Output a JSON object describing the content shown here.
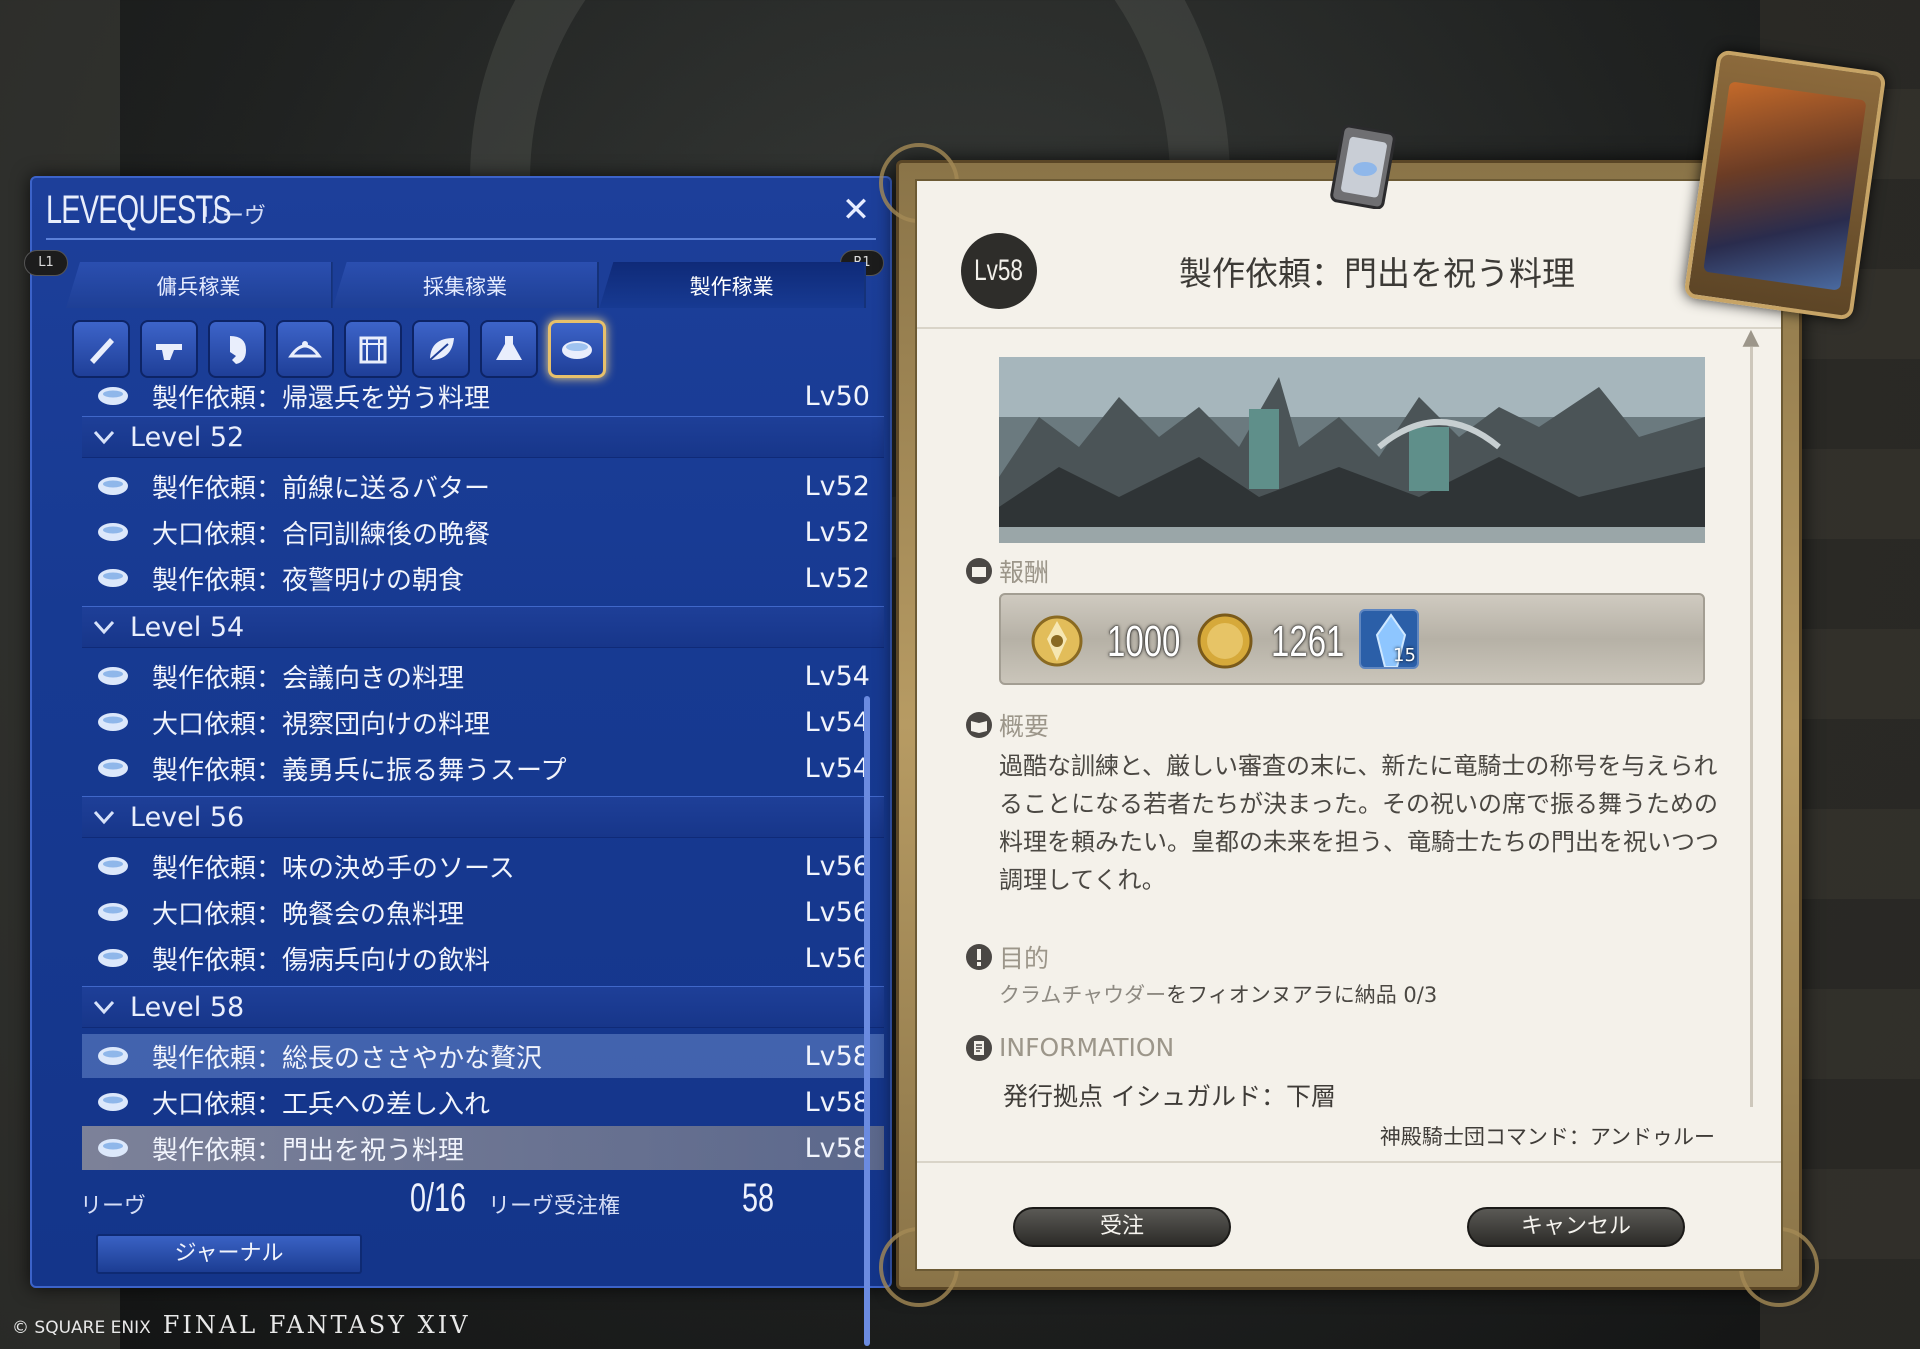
{
  "leve_panel": {
    "title_main": "LEVEQUESTS",
    "title_sub": "リーヴ",
    "close": "✕",
    "left_trigger": "L1",
    "right_trigger": "R1",
    "tabs": [
      {
        "label": "傭兵稼業"
      },
      {
        "label": "採集稼業"
      },
      {
        "label": "製作稼業"
      }
    ],
    "active_tab": "製作稼業",
    "job_icons": [
      "carpenter-icon",
      "blacksmith-icon",
      "armorer-icon",
      "goldsmith-icon",
      "leatherworker-icon",
      "weaver-icon",
      "alchemist-icon",
      "culinarian-icon"
    ],
    "selected_job_icon": "culinarian-icon",
    "list": {
      "partial_row": {
        "title": "製作依頼：帰還兵を労う料理",
        "level": "Lv50"
      },
      "groups": [
        {
          "header": "Level 52",
          "quests": [
            {
              "title": "製作依頼：前線に送るバター",
              "level": "Lv52"
            },
            {
              "title": "大口依頼：合同訓練後の晩餐",
              "level": "Lv52"
            },
            {
              "title": "製作依頼：夜警明けの朝食",
              "level": "Lv52"
            }
          ]
        },
        {
          "header": "Level 54",
          "quests": [
            {
              "title": "製作依頼：会議向きの料理",
              "level": "Lv54"
            },
            {
              "title": "大口依頼：視察団向けの料理",
              "level": "Lv54"
            },
            {
              "title": "製作依頼：義勇兵に振る舞うスープ",
              "level": "Lv54"
            }
          ]
        },
        {
          "header": "Level 56",
          "quests": [
            {
              "title": "製作依頼：味の決め手のソース",
              "level": "Lv56"
            },
            {
              "title": "大口依頼：晩餐会の魚料理",
              "level": "Lv56"
            },
            {
              "title": "製作依頼：傷病兵向けの飲料",
              "level": "Lv56"
            }
          ]
        },
        {
          "header": "Level 58",
          "quests": [
            {
              "title": "製作依頼：総長のささやかな贅沢",
              "level": "Lv58"
            },
            {
              "title": "大口依頼：工兵への差し入れ",
              "level": "Lv58"
            },
            {
              "title": "製作依頼：門出を祝う料理",
              "level": "Lv58"
            }
          ]
        }
      ]
    },
    "footer": {
      "leves_label": "リーヴ",
      "leves_count": "0/16",
      "allowance_label": "リーヴ受注権",
      "allowance_value": "58",
      "journal_button": "ジャーナル"
    }
  },
  "detail": {
    "level_badge": "Lv58",
    "title": "製作依頼：門出を祝う料理",
    "reward_label": "報酬",
    "rewards": {
      "exp": "1000",
      "gil": "1261",
      "crystal_qty": "15"
    },
    "summary_label": "概要",
    "summary": "過酷な訓練と、厳しい審査の末に、新たに竜騎士の称号を与えられることになる若者たちが決まった。その祝いの席で振る舞うための料理を頼みたい。皇都の未来を担う、竜騎士たちの門出を祝いつつ調理してくれ。",
    "objective_label": "目的",
    "objective_item": "クラムチャウダー",
    "objective_rest": "をフィオンヌアラに納品 0/3",
    "info_label": "INFORMATION",
    "issuer": "発行拠点 イシュガルド：下層",
    "client": "神殿騎士団コマンド：アンドゥルー",
    "accept_button": "受注",
    "cancel_button": "キャンセル"
  },
  "copyright": {
    "publisher": "© SQUARE ENIX",
    "game": "FINAL FANTASY XIV"
  },
  "colors": {
    "panel_blue": "#173a92",
    "selected_gold": "#e7c06b",
    "parchment": "#f4f1ea"
  }
}
